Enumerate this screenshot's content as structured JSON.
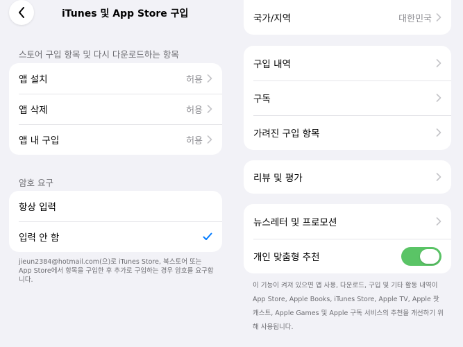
{
  "nav": {
    "title": "iTunes 및 App Store 구입"
  },
  "left": {
    "store_section": {
      "header": "스토어 구입 항목 및 다시 다운로드하는 항목",
      "rows": [
        {
          "label": "앱 설치",
          "value": "허용"
        },
        {
          "label": "앱 삭제",
          "value": "허용"
        },
        {
          "label": "앱 내 구입",
          "value": "허용"
        }
      ]
    },
    "password_section": {
      "header": "암호 요구",
      "rows": [
        {
          "label": "항상 입력"
        },
        {
          "label": "입력 안 함"
        }
      ],
      "footnote": "jieun2384@hotmail.com(으)로 iTunes Store, 북스토어 또는 App Store에서 항목을 구입한 후 추가로 구입하는 경우 암호를 요구합니다."
    }
  },
  "right": {
    "region": {
      "label": "국가/지역",
      "value": "대한민국"
    },
    "purchases": {
      "rows": [
        {
          "label": "구입 내역"
        },
        {
          "label": "구독"
        },
        {
          "label": "가려진 구입 항목"
        }
      ]
    },
    "ratings": {
      "label": "리뷰 및 평가"
    },
    "marketing": {
      "newsletter_label": "뉴스레터 및 프로모션",
      "personalized_label": "개인 맞춤형 추천",
      "personalized_on": true,
      "footnote": "이 기능이 켜져 있으면 앱 사용, 다운로드, 구입 및 기타 활동 내역이 App Store, Apple Books, iTunes Store, Apple TV, Apple 팟캐스트, Apple Games 및 Apple 구독 서비스의 추천을 개선하기 위해 사용됩니다."
    }
  },
  "colors": {
    "background": "#f2f2f7",
    "accent": "#007aff",
    "toggle_on": "#5ac466",
    "secondary_text": "#8e8e93"
  }
}
